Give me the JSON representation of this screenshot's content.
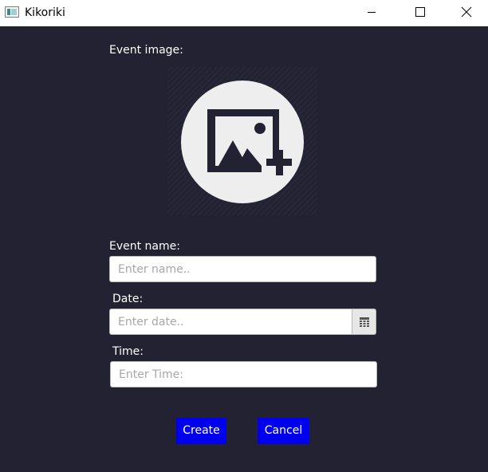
{
  "window": {
    "title": "Kikoriki",
    "controls": [
      "minimize-icon",
      "maximize-icon",
      "close-icon"
    ]
  },
  "form": {
    "image_label": "Event image:",
    "image_icon": "add-image-icon",
    "name_label": "Event name:",
    "name_placeholder": "Enter name..",
    "date_label": "Date:",
    "date_placeholder": "Enter date..",
    "date_picker_icon": "calendar-icon",
    "time_label": "Time:",
    "time_placeholder": "Enter Time:"
  },
  "actions": {
    "create_label": "Create",
    "cancel_label": "Cancel"
  },
  "colors": {
    "background": "#232232",
    "button": "#0000ee",
    "image_circle": "#eeeeee",
    "icon": "#232232"
  }
}
